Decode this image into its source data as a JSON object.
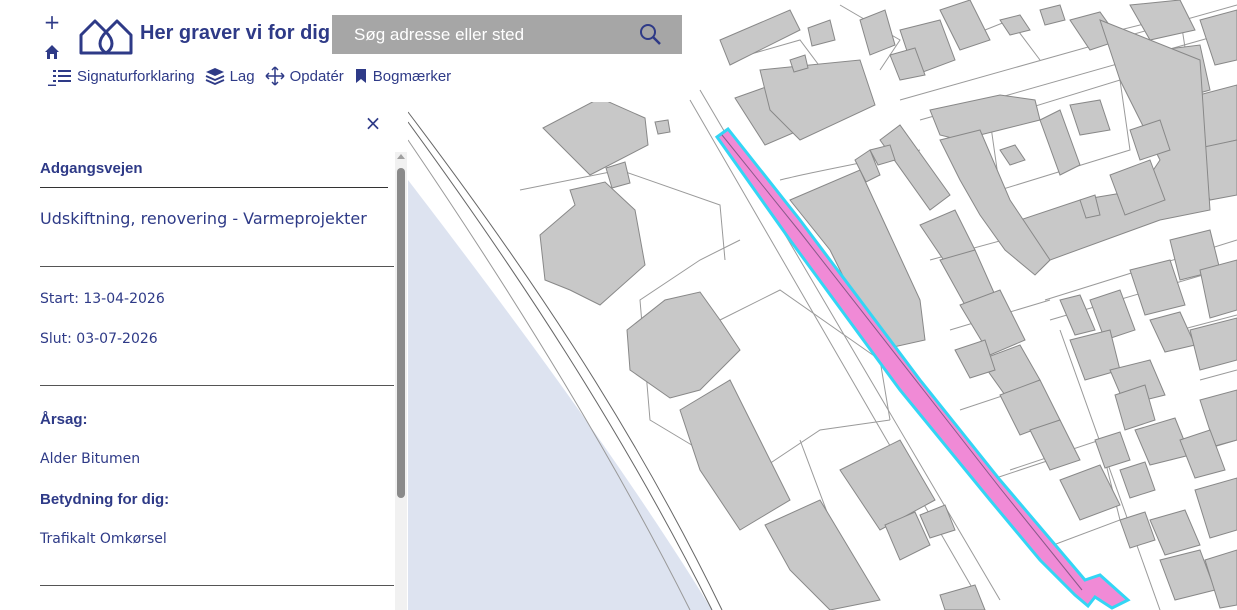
{
  "app": {
    "title": "Her graver vi for dig"
  },
  "search": {
    "placeholder": "Søg adresse eller sted"
  },
  "zoom": {
    "in_label": "+",
    "home_icon": "home-icon",
    "out_label": "–"
  },
  "menu": [
    {
      "label": "Signaturforklaring",
      "icon": "list-icon"
    },
    {
      "label": "Lag",
      "icon": "layers-icon"
    },
    {
      "label": "Opdatér",
      "icon": "move-icon"
    },
    {
      "label": "Bogmærker",
      "icon": "bookmark-icon"
    }
  ],
  "panel": {
    "close_label": "×",
    "road_name": "Adgangsvejen",
    "project_type": "Udskiftning, renovering - Varmeprojekter",
    "start": "Start: 13-04-2026",
    "end": "Slut: 03-07-2026",
    "reason_heading": "Årsag:",
    "reason": "Alder Bitumen",
    "impact_heading": "Betydning for dig:",
    "impact": "Trafikalt Omkørsel"
  },
  "colors": {
    "brand": "#2e3a87",
    "water": "#dde3f0",
    "building_fill": "#c8c8c8",
    "building_stroke": "#888888",
    "excavation_fill": "#f08ad6",
    "excavation_outline": "#33d6f5",
    "search_bg": "#a6a6a6"
  }
}
